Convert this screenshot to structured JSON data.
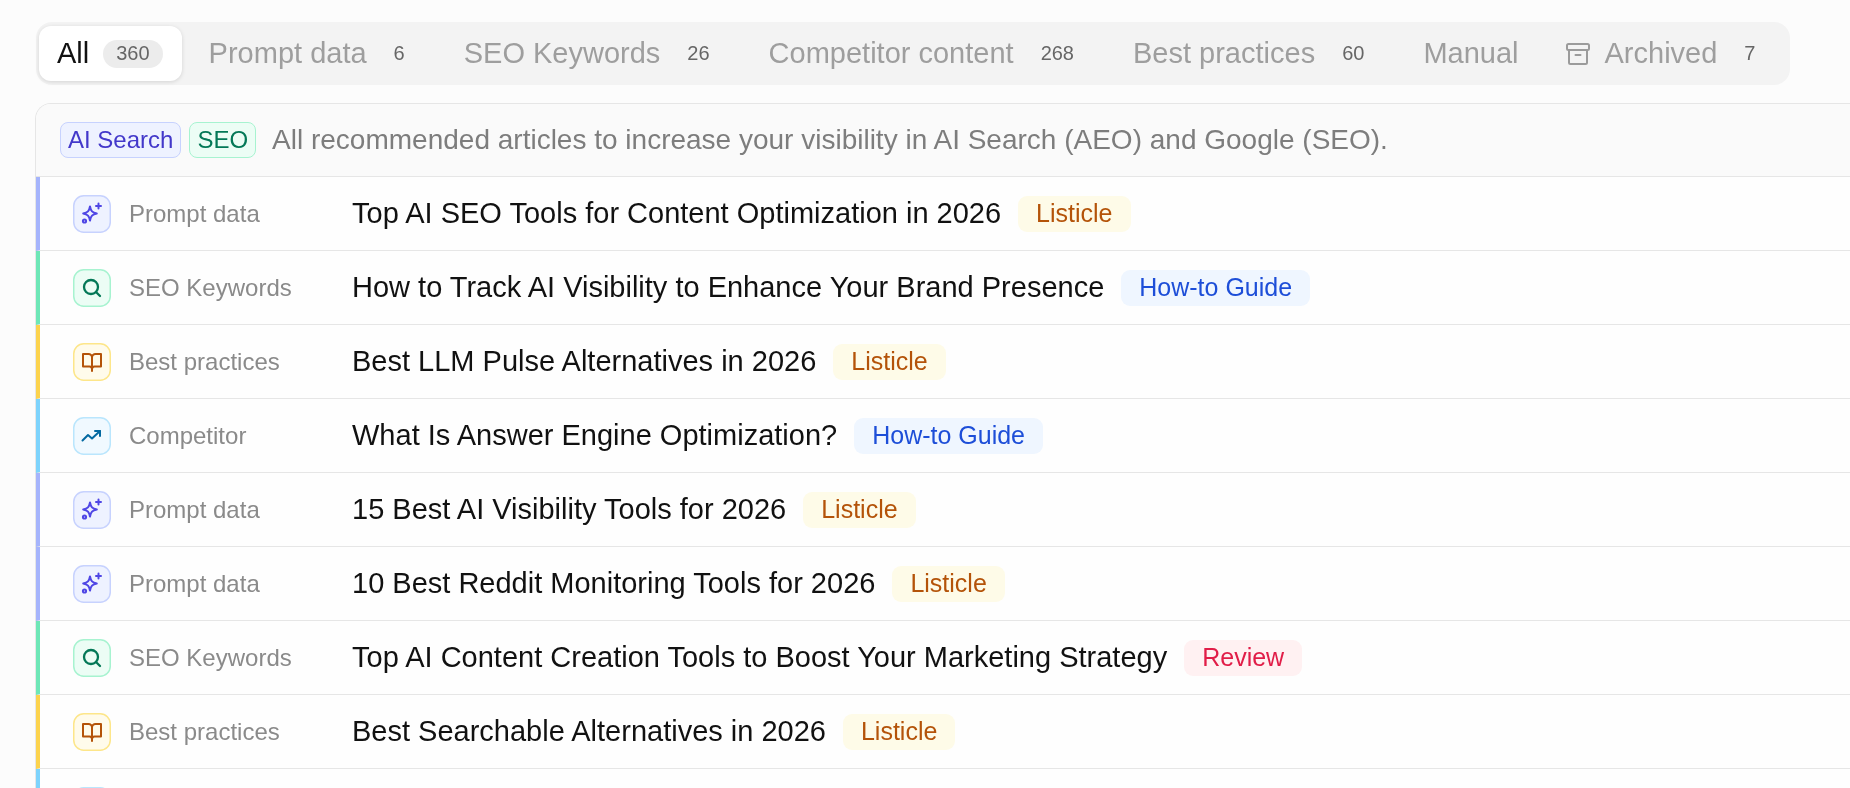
{
  "tabs": [
    {
      "kind": "filter",
      "label": "All",
      "count": "360",
      "selected": true
    },
    {
      "kind": "filter",
      "label": "Prompt data",
      "count": "6",
      "selected": false
    },
    {
      "kind": "filter",
      "label": "SEO Keywords",
      "count": "26",
      "selected": false
    },
    {
      "kind": "filter",
      "label": "Competitor content",
      "count": "268",
      "selected": false
    },
    {
      "kind": "filter",
      "label": "Best practices",
      "count": "60",
      "selected": false
    },
    {
      "kind": "filter",
      "label": "Manual",
      "selected": false
    },
    {
      "kind": "archive",
      "label": "Archived",
      "count": "7",
      "selected": false
    }
  ],
  "list": {
    "tags": [
      {
        "kind": "aeo",
        "label": "AI Search"
      },
      {
        "kind": "seo",
        "label": "SEO"
      }
    ],
    "description": "All recommended articles to increase your visibility in AI Search (AEO) and Google (SEO).",
    "rows": [
      {
        "kind": "prompt",
        "source": "Prompt data",
        "title": "Top AI SEO Tools for Content Optimization in 2026",
        "format": {
          "kind": "listicle",
          "label": "Listicle"
        }
      },
      {
        "kind": "seo",
        "source": "SEO Keywords",
        "title": "How to Track AI Visibility to Enhance Your Brand Presence",
        "format": {
          "kind": "guide",
          "label": "How-to Guide"
        }
      },
      {
        "kind": "practices",
        "source": "Best practices",
        "title": "Best LLM Pulse Alternatives in 2026",
        "format": {
          "kind": "listicle",
          "label": "Listicle"
        }
      },
      {
        "kind": "competitor",
        "source": "Competitor",
        "title": "What Is Answer Engine Optimization?",
        "format": {
          "kind": "guide",
          "label": "How-to Guide"
        }
      },
      {
        "kind": "prompt",
        "source": "Prompt data",
        "title": "15 Best AI Visibility Tools for 2026",
        "format": {
          "kind": "listicle",
          "label": "Listicle"
        }
      },
      {
        "kind": "prompt",
        "source": "Prompt data",
        "title": "10 Best Reddit Monitoring Tools for 2026",
        "format": {
          "kind": "listicle",
          "label": "Listicle"
        }
      },
      {
        "kind": "seo",
        "source": "SEO Keywords",
        "title": "Top AI Content Creation Tools to Boost Your Marketing Strategy",
        "format": {
          "kind": "review",
          "label": "Review"
        }
      },
      {
        "kind": "practices",
        "source": "Best practices",
        "title": "Best Searchable Alternatives in 2026",
        "format": {
          "kind": "listicle",
          "label": "Listicle"
        }
      },
      {
        "kind": "competitor"
      }
    ]
  }
}
